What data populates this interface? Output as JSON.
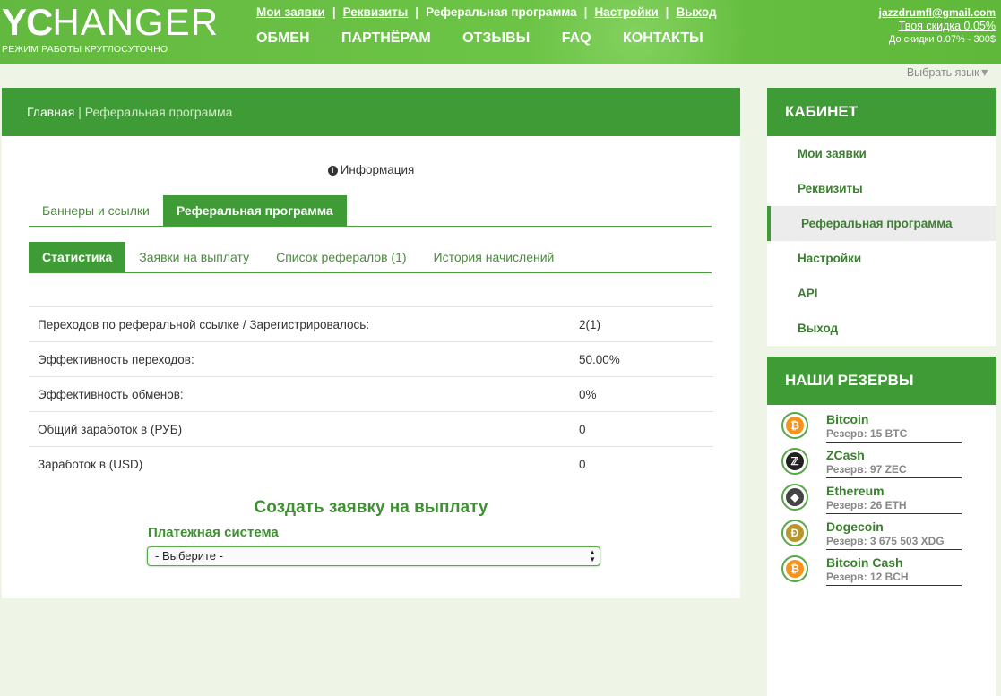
{
  "header": {
    "logo_bold": "YC",
    "logo_rest": "HANGER",
    "logo_tagline": "РЕЖИМ РАБОТЫ КРУГЛОСУТОЧНО",
    "top_links": [
      "Мои заявки",
      "Реквизиты",
      "Реферальная программа",
      "Настройки",
      "Выход"
    ],
    "main_nav": [
      "ОБМЕН",
      "ПАРТНЁРАМ",
      "ОТЗЫВЫ",
      "FAQ",
      "КОНТАКТЫ"
    ],
    "user_email": "jazzdrumfl@gmail.com",
    "discount": "Твоя скидка 0.05%",
    "next_discount": "До скидки 0.07% - 300$",
    "language": "Выбрать язык"
  },
  "breadcrumb": {
    "home": "Главная",
    "separator": "|",
    "current": "Реферальная программа"
  },
  "info_label": "Информация",
  "tabs_top": [
    {
      "label": "Баннеры и ссылки",
      "active": false
    },
    {
      "label": "Реферальная программа",
      "active": true
    }
  ],
  "tabs_sub": [
    {
      "label": "Статистика",
      "active": true
    },
    {
      "label": "Заявки на выплату",
      "active": false
    },
    {
      "label": "Список рефералов (1)",
      "active": false
    },
    {
      "label": "История начислений",
      "active": false
    }
  ],
  "stats": [
    {
      "label": "Переходов по реферальной ссылке / Зарегистрировалось:",
      "value": "2(1)"
    },
    {
      "label": "Эффективность переходов:",
      "value": "50.00%"
    },
    {
      "label": "Эффективность обменов:",
      "value": "0%"
    },
    {
      "label": "Общий заработок в (РУБ)",
      "value": "0"
    },
    {
      "label": "Заработок в (USD)",
      "value": "0"
    }
  ],
  "payout": {
    "title": "Создать заявку на выплату",
    "system_label": "Платежная система",
    "select_value": "- Выберите -"
  },
  "sidebar": {
    "cabinet_title": "КАБИНЕТ",
    "menu": [
      {
        "label": "Мои заявки",
        "active": false
      },
      {
        "label": "Реквизиты",
        "active": false
      },
      {
        "label": "Реферальная программа",
        "active": true
      },
      {
        "label": "Настройки",
        "active": false
      },
      {
        "label": "API",
        "active": false
      },
      {
        "label": "Выход",
        "active": false
      }
    ],
    "reserves_title": "НАШИ РЕЗЕРВЫ",
    "reserves": [
      {
        "name": "Bitcoin",
        "amount": "Резерв: 15 BTC",
        "icon": "bitcoin-icon",
        "color": "#f7931a",
        "glyph": "₿"
      },
      {
        "name": "ZCash",
        "amount": "Резерв: 97 ZEC",
        "icon": "zcash-icon",
        "color": "#222222",
        "glyph": "ℤ"
      },
      {
        "name": "Ethereum",
        "amount": "Резерв: 26 ETH",
        "icon": "ethereum-icon",
        "color": "#444444",
        "glyph": "◆"
      },
      {
        "name": "Dogecoin",
        "amount": "Резерв: 3 675 503 XDG",
        "icon": "dogecoin-icon",
        "color": "#b8962e",
        "glyph": "Ð"
      },
      {
        "name": "Bitcoin Cash",
        "amount": "Резерв: 12 BCH",
        "icon": "bitcoin-cash-icon",
        "color": "#f7931a",
        "glyph": "₿"
      }
    ]
  },
  "colors": {
    "brand_green": "#3f9b35",
    "header_green": "#6cc446",
    "link_green": "#3c7f31"
  }
}
